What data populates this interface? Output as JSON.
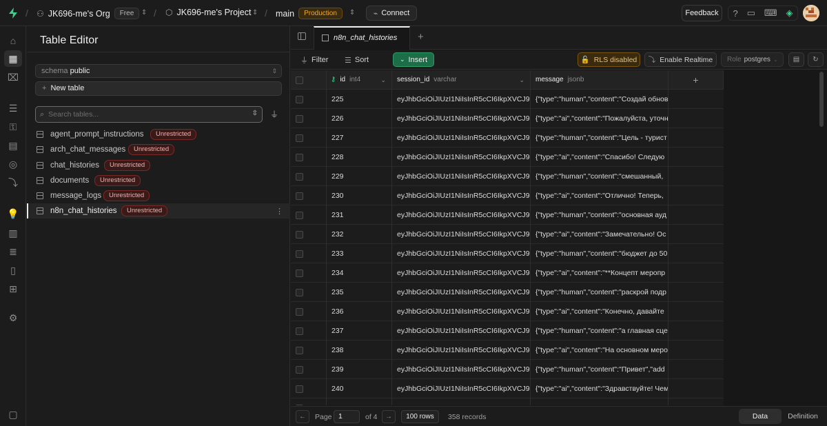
{
  "topbar": {
    "org": "JK696-me's Org",
    "org_plan": "Free",
    "project": "JK696-me's Project",
    "branch": "main",
    "env": "Production",
    "connect": "Connect",
    "feedback": "Feedback"
  },
  "sidebar": {
    "title": "Table Editor",
    "schema_label": "schema",
    "schema_value": "public",
    "new_table": "New table",
    "search_placeholder": "Search tables...",
    "tables": [
      {
        "name": "agent_prompt_instructions",
        "badge": "Unrestricted"
      },
      {
        "name": "arch_chat_messages",
        "badge": "Unrestricted"
      },
      {
        "name": "chat_histories",
        "badge": "Unrestricted"
      },
      {
        "name": "documents",
        "badge": "Unrestricted"
      },
      {
        "name": "message_logs",
        "badge": "Unrestricted"
      },
      {
        "name": "n8n_chat_histories",
        "badge": "Unrestricted"
      }
    ]
  },
  "tab": {
    "label": "n8n_chat_histories"
  },
  "toolbar": {
    "filter": "Filter",
    "sort": "Sort",
    "insert": "Insert",
    "rls": "RLS disabled",
    "realtime": "Enable Realtime",
    "role_label": "Role",
    "role_value": "postgres"
  },
  "grid": {
    "columns": [
      {
        "name": "id",
        "type": "int4"
      },
      {
        "name": "session_id",
        "type": "varchar"
      },
      {
        "name": "message",
        "type": "jsonb"
      }
    ],
    "rows": [
      {
        "id": "225",
        "session_id": "eyJhbGciOiJIUzI1NiIsInR5cCI6IkpXVCJ9.",
        "message": "{\"type\":\"human\",\"content\":\"Создай обнов"
      },
      {
        "id": "226",
        "session_id": "eyJhbGciOiJIUzI1NiIsInR5cCI6IkpXVCJ9.",
        "message": "{\"type\":\"ai\",\"content\":\"Пожалуйста, уточн"
      },
      {
        "id": "227",
        "session_id": "eyJhbGciOiJIUzI1NiIsInR5cCI6IkpXVCJ9.",
        "message": "{\"type\":\"human\",\"content\":\"Цель - турист"
      },
      {
        "id": "228",
        "session_id": "eyJhbGciOiJIUzI1NiIsInR5cCI6IkpXVCJ9.",
        "message": "{\"type\":\"ai\",\"content\":\"Спасибо! Следую"
      },
      {
        "id": "229",
        "session_id": "eyJhbGciOiJIUzI1NiIsInR5cCI6IkpXVCJ9.",
        "message": "{\"type\":\"human\",\"content\":\"смешанный, "
      },
      {
        "id": "230",
        "session_id": "eyJhbGciOiJIUzI1NiIsInR5cCI6IkpXVCJ9.",
        "message": "{\"type\":\"ai\",\"content\":\"Отлично! Теперь,"
      },
      {
        "id": "231",
        "session_id": "eyJhbGciOiJIUzI1NiIsInR5cCI6IkpXVCJ9.",
        "message": "{\"type\":\"human\",\"content\":\"основная ауд"
      },
      {
        "id": "232",
        "session_id": "eyJhbGciOiJIUzI1NiIsInR5cCI6IkpXVCJ9.",
        "message": "{\"type\":\"ai\",\"content\":\"Замечательно! Ос"
      },
      {
        "id": "233",
        "session_id": "eyJhbGciOiJIUzI1NiIsInR5cCI6IkpXVCJ9.",
        "message": "{\"type\":\"human\",\"content\":\"бюджет до 50"
      },
      {
        "id": "234",
        "session_id": "eyJhbGciOiJIUzI1NiIsInR5cCI6IkpXVCJ9.",
        "message": "{\"type\":\"ai\",\"content\":\"**Концепт меропр"
      },
      {
        "id": "235",
        "session_id": "eyJhbGciOiJIUzI1NiIsInR5cCI6IkpXVCJ9.",
        "message": "{\"type\":\"human\",\"content\":\"раскрой подр"
      },
      {
        "id": "236",
        "session_id": "eyJhbGciOiJIUzI1NiIsInR5cCI6IkpXVCJ9.",
        "message": "{\"type\":\"ai\",\"content\":\"Конечно, давайте"
      },
      {
        "id": "237",
        "session_id": "eyJhbGciOiJIUzI1NiIsInR5cCI6IkpXVCJ9.",
        "message": "{\"type\":\"human\",\"content\":\"а главная сце"
      },
      {
        "id": "238",
        "session_id": "eyJhbGciOiJIUzI1NiIsInR5cCI6IkpXVCJ9.",
        "message": "{\"type\":\"ai\",\"content\":\"На основном меро"
      },
      {
        "id": "239",
        "session_id": "eyJhbGciOiJIUzI1NiIsInR5cCI6IkpXVCJ9.",
        "message": "{\"type\":\"human\",\"content\":\"Привет\",\"add"
      },
      {
        "id": "240",
        "session_id": "eyJhbGciOiJIUzI1NiIsInR5cCI6IkpXVCJ9.",
        "message": "{\"type\":\"ai\",\"content\":\"Здравствуйте! Чем"
      }
    ]
  },
  "footer": {
    "page_label": "Page",
    "page_value": "1",
    "of_pages": "of 4",
    "rows": "100 rows",
    "records": "358 records",
    "view_data": "Data",
    "view_definition": "Definition"
  }
}
